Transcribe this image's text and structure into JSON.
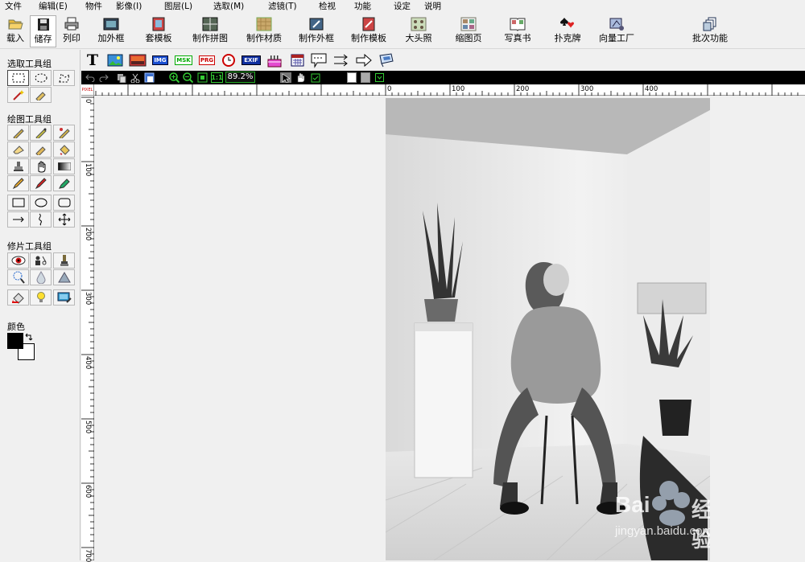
{
  "menu": [
    "文件",
    "编辑(E)",
    "物件",
    "影像(I)",
    "图层(L)",
    "选取(M)",
    "滤镜(T)",
    "检视",
    "功能",
    "设定",
    "说明"
  ],
  "toolbar": {
    "load": "载入",
    "save": "储存",
    "print": "列印",
    "add_frame": "加外框",
    "template": "套模板",
    "collage": "制作拼图",
    "material": "制作材质",
    "make_frame": "制作外框",
    "make_template": "制作模板",
    "big_head": "大头照",
    "thumbnail": "缩图页",
    "photo_book": "写真书",
    "poker": "扑克牌",
    "vector": "向量工厂",
    "batch": "批次功能"
  },
  "left_panel": {
    "select_group": "选取工具组",
    "draw_group": "绘图工具组",
    "retouch_group": "修片工具组",
    "color_label": "颜色",
    "foreground": "#000000",
    "background": "#ffffff"
  },
  "objbar": {
    "text_icon": "T",
    "img": "IMG",
    "msk": "MSK",
    "prg": "PRG",
    "exif": "EXIF"
  },
  "viewbar": {
    "zoom_label": "89.2%",
    "actual": "1:1"
  },
  "ruler": {
    "corner": "PIXEL",
    "h_labels": [
      "0",
      "100",
      "200",
      "300",
      "400"
    ],
    "v_labels": [
      "0",
      "100",
      "200",
      "300",
      "400",
      "500",
      "600",
      "700"
    ]
  },
  "watermark": {
    "brand": "Bai",
    "brand2": "经验",
    "url": "jingyan.baidu.com"
  }
}
